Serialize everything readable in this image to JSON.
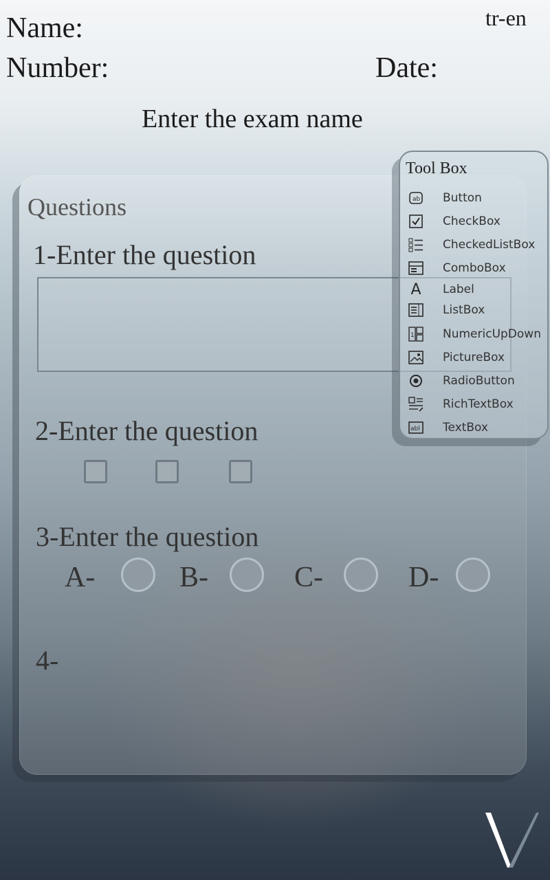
{
  "header": {
    "name_label": "Name:",
    "number_label": "Number:",
    "date_label": "Date:",
    "language": "tr-en",
    "exam_title": "Enter the exam name"
  },
  "questions": {
    "title": "Questions",
    "q1": {
      "text": "1-Enter the question",
      "answer_value": ""
    },
    "q2": {
      "text": "2-Enter the question",
      "checkbox_count": 3
    },
    "q3": {
      "text": "3-Enter the question",
      "options": [
        "A-",
        "B-",
        "C-",
        "D-"
      ]
    },
    "q4": {
      "text": "4-"
    }
  },
  "toolbox": {
    "title": "Tool Box",
    "items": [
      {
        "label": "Button",
        "icon": "button-icon"
      },
      {
        "label": "CheckBox",
        "icon": "checkbox-icon"
      },
      {
        "label": "CheckedListBox",
        "icon": "checkedlistbox-icon"
      },
      {
        "label": "ComboBox",
        "icon": "combobox-icon"
      },
      {
        "label": "Label",
        "icon": "label-icon"
      },
      {
        "label": "ListBox",
        "icon": "listbox-icon"
      },
      {
        "label": "NumericUpDown",
        "icon": "numericupdown-icon"
      },
      {
        "label": "PictureBox",
        "icon": "picturebox-icon"
      },
      {
        "label": "RadioButton",
        "icon": "radiobutton-icon"
      },
      {
        "label": "RichTextBox",
        "icon": "richtextbox-icon"
      },
      {
        "label": "TextBox",
        "icon": "textbox-icon"
      }
    ]
  },
  "colors": {
    "text": "#1b1b1b",
    "panel_border": "#7f8b93"
  }
}
